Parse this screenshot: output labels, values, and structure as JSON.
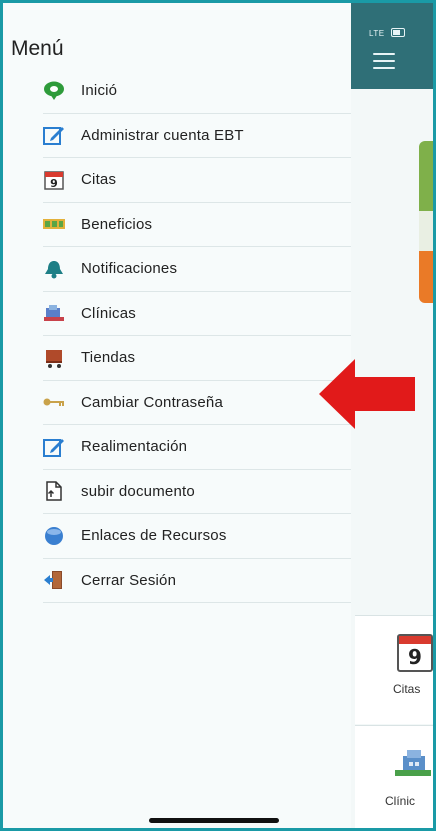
{
  "drawer": {
    "title": "Menú",
    "items": [
      {
        "label": "Inició",
        "icon": "home-location-icon"
      },
      {
        "label": "Administrar cuenta EBT",
        "icon": "edit-icon"
      },
      {
        "label": "Citas",
        "icon": "calendar-icon"
      },
      {
        "label": "Beneficios",
        "icon": "benefits-icon"
      },
      {
        "label": "Notificaciones",
        "icon": "bell-icon"
      },
      {
        "label": "Clínicas",
        "icon": "clinic-icon"
      },
      {
        "label": "Tiendas",
        "icon": "cart-icon"
      },
      {
        "label": "Cambiar Contraseña",
        "icon": "key-icon"
      },
      {
        "label": "Realimentación",
        "icon": "feedback-icon"
      },
      {
        "label": "subir documento",
        "icon": "upload-document-icon"
      },
      {
        "label": "Enlaces de Recursos",
        "icon": "globe-icon"
      },
      {
        "label": "Cerrar Sesión",
        "icon": "logout-door-icon"
      }
    ]
  },
  "status_bar": {
    "network": "LTE"
  },
  "tiles": {
    "calendar_day": "9",
    "citas_label": "Citas",
    "clinicas_label": "Clínic"
  },
  "colors": {
    "frame_border": "#1a9aa6",
    "header": "#2f6f77",
    "annotation_arrow": "#e11a1a"
  }
}
